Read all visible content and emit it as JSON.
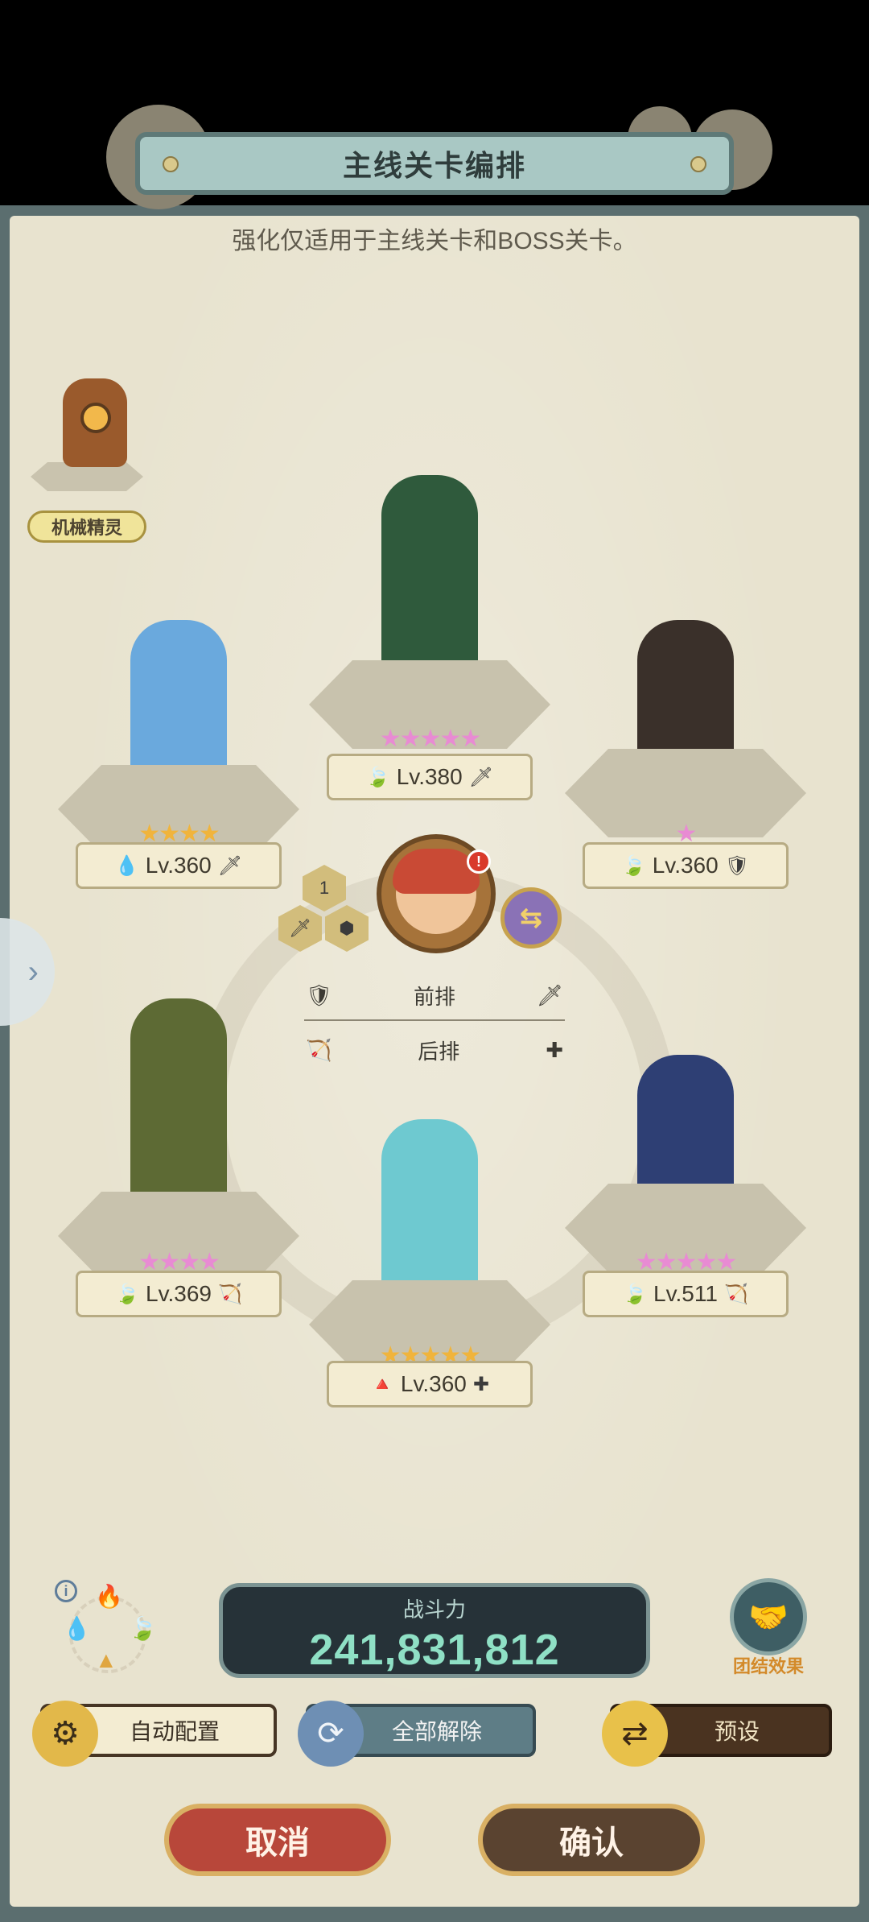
{
  "header": {
    "title": "主线关卡编排",
    "subtitle": "强化仅适用于主线关卡和BOSS关卡。"
  },
  "spirit": {
    "label": "机械精灵"
  },
  "heroes": [
    {
      "slot": "top-center",
      "stars": "★★★★★",
      "star_color": "#e88bd3",
      "element_icon": "🍃",
      "level": "Lv.380",
      "role_icon": "🗡"
    },
    {
      "slot": "mid-left",
      "stars": "★★★★",
      "star_color": "#f0b43c",
      "element_icon": "💧",
      "level": "Lv.360",
      "role_icon": "🗡"
    },
    {
      "slot": "mid-right",
      "stars": "★",
      "star_color": "#e88bd3",
      "element_icon": "🍃",
      "level": "Lv.360",
      "role_icon": "🛡"
    },
    {
      "slot": "bottom-left",
      "stars": "★★★★",
      "star_color": "#e88bd3",
      "element_icon": "🍃",
      "level": "Lv.369",
      "role_icon": "🏹"
    },
    {
      "slot": "bottom-right",
      "stars": "★★★★★",
      "star_color": "#e88bd3",
      "element_icon": "🍃",
      "level": "Lv.511",
      "role_icon": "🏹"
    },
    {
      "slot": "bottom-center",
      "stars": "★★★★★",
      "star_color": "#f0b43c",
      "element_icon": "🔺",
      "level": "Lv.360",
      "role_icon": "✚"
    }
  ],
  "center": {
    "slot_number": "1",
    "badge": "!",
    "swap_icon": "swap-icon"
  },
  "formation": {
    "front_label": "前排",
    "back_label": "后排"
  },
  "power": {
    "label": "战斗力",
    "value": "241,831,812"
  },
  "team_effect": {
    "label": "团结效果"
  },
  "buttons": {
    "auto": "自动配置",
    "clear": "全部解除",
    "preset": "预设",
    "cancel": "取消",
    "confirm": "确认"
  },
  "colors": {
    "panel": "#e8e3cf",
    "title_bar": "#a9c8c4",
    "power_bg": "#263238",
    "power_text": "#8fe0c5",
    "cancel": "#b8473a",
    "confirm": "#5a4330"
  }
}
